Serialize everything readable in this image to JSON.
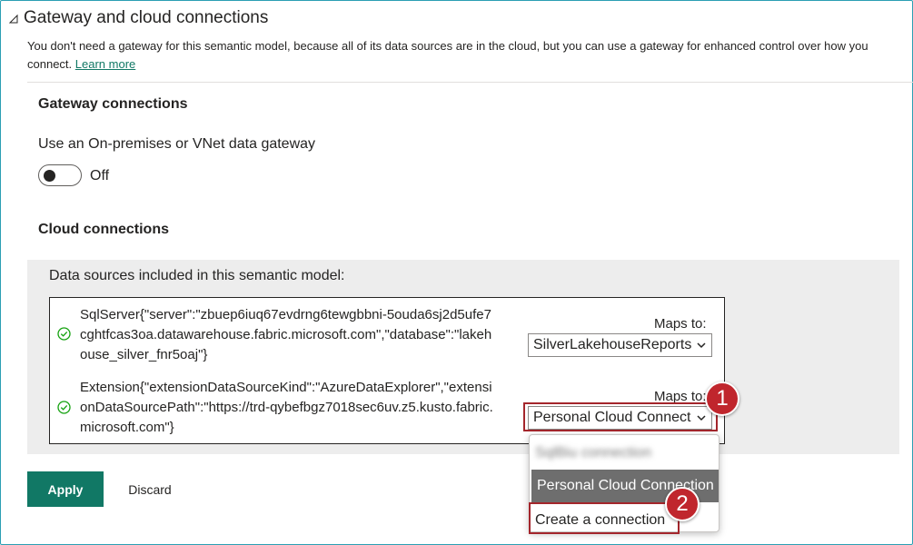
{
  "section": {
    "title": "Gateway and cloud connections",
    "description": "You don't need a gateway for this semantic model, because all of its data sources are in the cloud, but you can use a gateway for enhanced control over how you connect.",
    "learn_more": "Learn more"
  },
  "gateway": {
    "heading": "Gateway connections",
    "toggle_label": "Use an On-premises or VNet data gateway",
    "toggle_state": "Off"
  },
  "cloud": {
    "heading": "Cloud connections",
    "panel_label": "Data sources included in this semantic model:",
    "sources": [
      {
        "text": "SqlServer{\"server\":\"zbuep6iuq67evdrng6tewgbbni-5ouda6sj2d5ufe7cghtfcas3oa.datawarehouse.fabric.microsoft.com\",\"database\":\"lakehouse_silver_fnr5oaj\"}",
        "maps_label": "Maps to:",
        "selected": "SilverLakehouseReports"
      },
      {
        "text": "Extension{\"extensionDataSourceKind\":\"AzureDataExplorer\",\"extensionDataSourcePath\":\"https://trd-qybefbgz7018sec6uv.z5.kusto.fabric.microsoft.com\"}",
        "maps_label": "Maps to:",
        "selected": "Personal Cloud Connect"
      }
    ]
  },
  "dropdown": {
    "options": [
      "SqlBiu connection",
      "Personal Cloud Connection",
      "Create a connection"
    ]
  },
  "badges": [
    "1",
    "2"
  ],
  "buttons": {
    "apply": "Apply",
    "discard": "Discard"
  },
  "colors": {
    "accent": "#117865",
    "frame": "#2b9fb3",
    "highlight": "#a4262c",
    "badge": "#c0262d",
    "status_ok": "#13a10e"
  }
}
